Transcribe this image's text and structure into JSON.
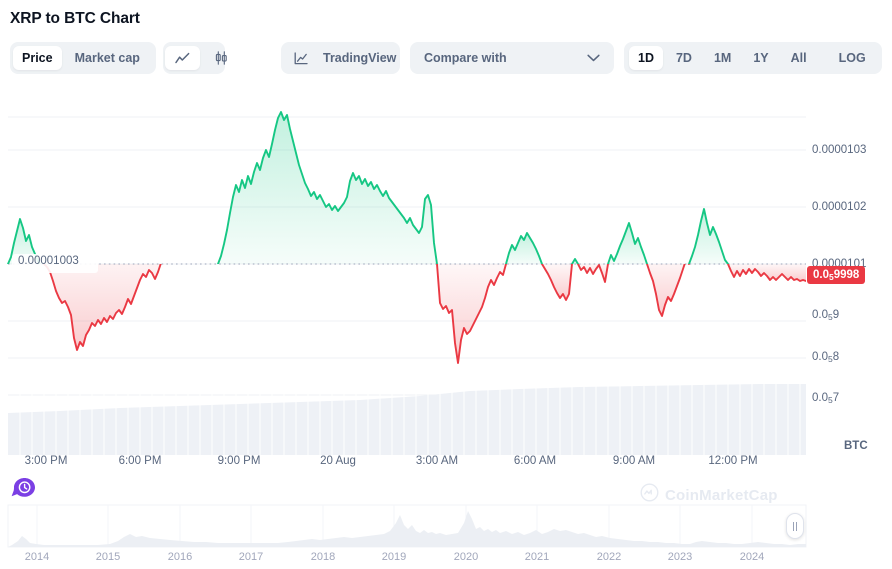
{
  "header": {
    "title": "XRP to BTC Chart"
  },
  "toolbar": {
    "price_label": "Price",
    "marketcap_label": "Market cap",
    "line_icon": "line-chart-icon",
    "candle_icon": "candlestick-icon",
    "tradingview_label": "TradingView",
    "tradingview_icon": "tradingview-chart-icon",
    "compare_label": "Compare with",
    "compare_chevron": "chevron-down-icon",
    "ranges": [
      "1D",
      "7D",
      "1M",
      "1Y",
      "All"
    ],
    "active_range": "1D",
    "log_label": "LOG",
    "more_label": "···"
  },
  "chart": {
    "baseline_label": "0.00001003",
    "current_price_prefix": "0.0",
    "current_price_sub": "5",
    "current_price_suffix": "9998",
    "unit": "BTC",
    "watermark": "CoinMarketCap",
    "green_color": "#16c784",
    "red_color": "#ea3943",
    "history_icon": "history-clock-pin-icon"
  },
  "chart_data": {
    "type": "line",
    "title": "XRP to BTC Chart",
    "xlabel": "",
    "ylabel": "BTC",
    "grid": true,
    "legend": "none",
    "baseline": 1.003e-05,
    "ylim": [
      9.6e-06,
      1.036e-05
    ],
    "yticks": [
      1.03e-05,
      1.02e-05,
      1.01e-05,
      9.99e-06,
      9.98e-06,
      9.97e-06
    ],
    "ytick_labels": [
      "0.0000103",
      "0.0000102",
      "0.0000101",
      "0.0₅9 9",
      "0.0₅9 8",
      "0.0₅9 7"
    ],
    "ytick_labels_plain": [
      "0.0000103",
      "0.0000102",
      "0.0000101",
      "0.059 9",
      "0.059 8",
      "0.059 7"
    ],
    "xticks": [
      "3:00 PM",
      "6:00 PM",
      "9:00 PM",
      "20 Aug",
      "3:00 AM",
      "6:00 AM",
      "9:00 AM",
      "12:00 PM"
    ],
    "current_value": 9.998e-06,
    "series": [
      {
        "name": "XRP/BTC",
        "color_above_baseline": "#16c784",
        "color_below_baseline": "#ea3943",
        "values": [
          1.003,
          1.0042,
          1.0068,
          1.009,
          1.0112,
          1.0095,
          1.007,
          1.0082,
          1.006,
          1.0048,
          1.0035,
          1.0026,
          1.003,
          1.0022,
          1.0012,
          1.0006,
          1.001,
          1.0004,
          0.9996,
          0.9978,
          0.996,
          0.9948,
          0.9938,
          0.9942,
          0.993,
          0.9916,
          0.9872,
          0.985,
          0.9866,
          0.9858,
          0.9878,
          0.9888,
          0.9902,
          0.9896,
          0.9908,
          0.99,
          0.9912,
          0.9906,
          0.9918,
          0.991,
          0.9924,
          0.9918,
          0.993,
          0.9936,
          0.9928,
          0.9942,
          0.9958,
          0.9948,
          0.9964,
          0.998,
          0.9996,
          1.0008,
          1.0002,
          1.0016,
          1.001,
          0.9998,
          1.0012,
          1.003,
          1.0052,
          1.0078,
          1.011,
          1.014,
          1.0162,
          1.015,
          1.0172,
          1.0158,
          1.018,
          1.0166,
          1.0188,
          1.0204,
          1.0192,
          1.0216,
          1.023,
          1.0218,
          1.0242,
          1.0268,
          1.029,
          1.0302,
          1.0288,
          1.0296,
          1.027,
          1.0248,
          1.0226,
          1.0204,
          1.0188,
          1.0172,
          1.016,
          1.0148,
          1.0156,
          1.0142,
          1.015,
          1.0138,
          1.0128,
          1.0134,
          1.0122,
          1.013,
          1.0118,
          1.0126,
          1.0134,
          1.0146,
          1.0176,
          1.019,
          1.0178,
          1.0186,
          1.017,
          1.018,
          1.0166,
          1.0174,
          1.016,
          1.0168,
          1.0156,
          1.0148,
          1.0158,
          1.0144,
          1.0136,
          1.0128,
          1.012,
          1.0112,
          1.0104,
          1.0096,
          1.0106,
          1.0092,
          1.0084,
          1.0076,
          1.0088,
          1.014,
          1.0148,
          1.013,
          1.006,
          0.998,
          0.9968,
          0.9974,
          0.996,
          0.9966,
          0.99,
          0.9862,
          0.9906,
          0.993,
          0.9918,
          0.9924,
          0.9936,
          0.9948,
          0.996,
          0.9972,
          0.999,
          1.0012,
          1.0026,
          1.0016,
          1.003,
          1.0042,
          1.0036,
          1.0048,
          1.004,
          1.003,
          1.002,
          1.0008,
          0.9994,
          0.9982,
          0.9972,
          0.998,
          0.9968,
          0.9976,
          0.9988,
          0.9996,
          0.9986,
          0.9992,
          0.998,
          0.999,
          1.0006,
          0.9996,
          0.9978,
          0.9962,
          0.995,
          0.9938,
          0.9912,
          0.988,
          0.9868,
          0.989,
          0.9906,
          0.9898,
          0.9912,
          0.9928,
          0.9944,
          0.996,
          0.9978,
          0.9996,
          1.0004,
          0.9994,
          1.001,
          1.0002,
          1.0014,
          1.0028,
          1.0042,
          1.003,
          1.0018,
          1.0006,
          0.9992,
          0.9978,
          0.996,
          0.9948,
          0.9962,
          0.9978,
          0.9992,
          1.0008,
          1.0026,
          1.0048,
          1.0074,
          1.0098,
          1.008,
          1.006,
          1.0072,
          1.0054,
          1.004,
          1.0024,
          1.0008,
          0.9996,
          1.0004,
          0.9992,
          0.9984,
          0.9994,
          0.9986,
          0.9996,
          0.999,
          0.9998,
          0.9992,
          0.9986,
          0.9994,
          0.9988,
          0.998,
          0.9986,
          0.998
        ],
        "value_scale_note": "values are price × 1e-5; baseline 1.0030 = 0.00001003"
      }
    ],
    "volume_band": {
      "type": "area",
      "description": "light grey volume bars along bottom of plot"
    },
    "navigator": {
      "type": "area",
      "xticks": [
        "2014",
        "2015",
        "2016",
        "2017",
        "2018",
        "2019",
        "2020",
        "2021",
        "2022",
        "2023",
        "2024"
      ]
    }
  }
}
